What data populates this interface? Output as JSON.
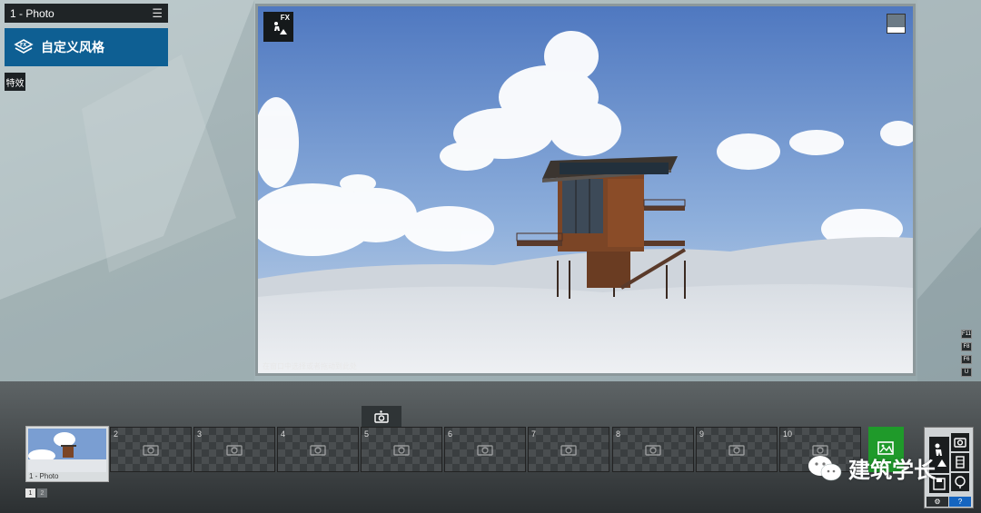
{
  "project": {
    "title": "1 - Photo",
    "menu_icon": "hamburger-icon"
  },
  "style_button": {
    "label": "自定义风格",
    "icon": "layers-icon"
  },
  "effects_button": {
    "label": "特效"
  },
  "viewport": {
    "fx_label": "FX",
    "hint": "在窗口中选择或者拖动到此处",
    "sky_color": "#6e8fc7",
    "snow_color": "#e3e6ea"
  },
  "shortcut_keys": [
    "F11",
    "F8",
    "F6",
    "U"
  ],
  "filmstrip": {
    "first_caption": "1 - Photo",
    "slots": [
      "2",
      "3",
      "4",
      "5",
      "6",
      "7",
      "8",
      "9",
      "10"
    ],
    "pages": [
      "1",
      "2"
    ]
  },
  "watermark": {
    "text": "建筑学长"
  },
  "panel": {
    "settings_icon": "gear-icon",
    "help_label": "?"
  },
  "colors": {
    "accent": "#0e5f93",
    "export": "#1f9a2a",
    "help": "#1565c0"
  }
}
